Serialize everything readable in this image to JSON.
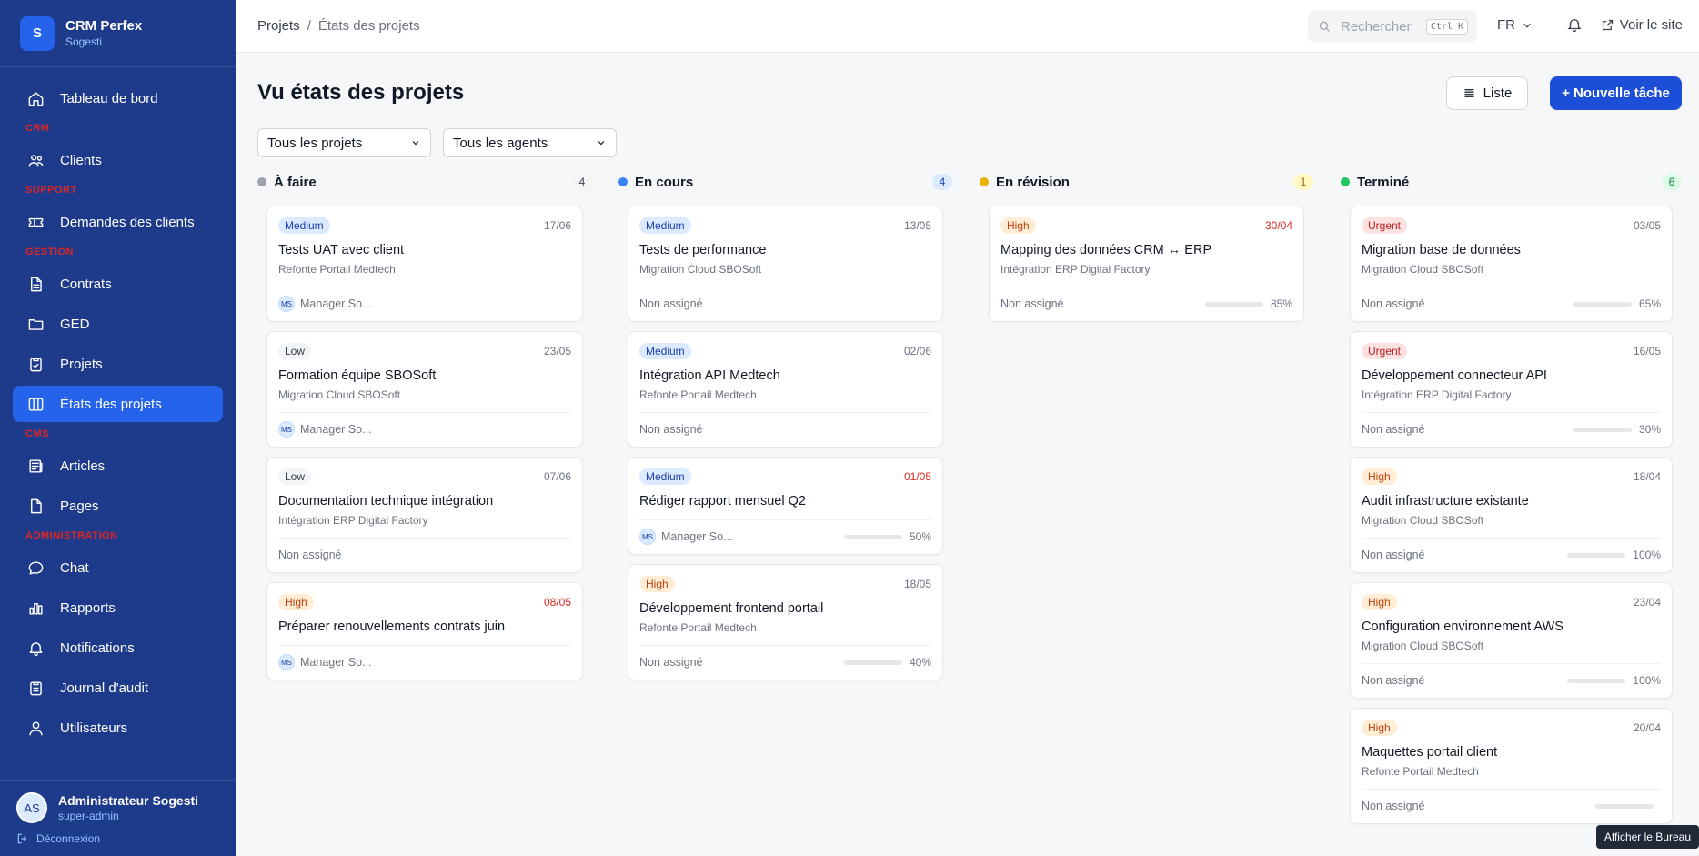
{
  "sidebar": {
    "brand_title": "CRM Perfex",
    "brand_sub": "Sogesti",
    "logo_letter": "S",
    "items": [
      {
        "label": "Tableau de bord"
      },
      {
        "label": "CRM"
      },
      {
        "label": "Clients"
      },
      {
        "label": "SUPPORT"
      },
      {
        "label": "Demandes des clients"
      },
      {
        "label": "GESTION"
      },
      {
        "label": "Contrats"
      },
      {
        "label": "GED"
      },
      {
        "label": "Projets"
      },
      {
        "label": "États des projets"
      },
      {
        "label": "CMS"
      },
      {
        "label": "Articles"
      },
      {
        "label": "Pages"
      },
      {
        "label": "ADMINISTRATION"
      },
      {
        "label": "Chat"
      },
      {
        "label": "Rapports"
      },
      {
        "label": "Notifications"
      },
      {
        "label": "Journal d'audit"
      },
      {
        "label": "Utilisateurs"
      }
    ],
    "user": {
      "initials": "AS",
      "name": "Administrateur Sogesti",
      "role": "super-admin",
      "logout": "Déconnexion"
    }
  },
  "topbar": {
    "breadcrumb_root": "Projets",
    "breadcrumb_sep": "/",
    "breadcrumb_current": "États des projets",
    "search_placeholder": "Rechercher",
    "search_kbd": "Ctrl K",
    "lang": "FR",
    "visit": "Voir le site"
  },
  "page": {
    "title": "Vu états des projets",
    "list_button": "Liste",
    "new_button": "+ Nouvelle tâche",
    "filter_projects": "Tous les projets",
    "filter_agents": "Tous les agents"
  },
  "colors": {
    "todo": "#9ca3af",
    "progress": "#3b82f6",
    "review": "#eab308",
    "done": "#22c55e",
    "accent": "#2563eb"
  },
  "columns": [
    {
      "title": "À faire",
      "count": "4",
      "cards": [
        {
          "priority": "Medium",
          "date": "17/06",
          "title": "Tests UAT avec client",
          "project": "Refonte Portail Medtech",
          "assignee": "Manager So...",
          "initials": "MS"
        },
        {
          "priority": "Low",
          "date": "23/05",
          "title": "Formation équipe SBOSoft",
          "project": "Migration Cloud SBOSoft",
          "assignee": "Manager So...",
          "initials": "MS"
        },
        {
          "priority": "Low",
          "date": "07/06",
          "title": "Documentation technique intégration",
          "project": "Intégration ERP Digital Factory",
          "assignee": "Non assigné"
        },
        {
          "priority": "High",
          "date": "08/05",
          "title": "Préparer renouvellements contrats juin",
          "assignee": "Manager So...",
          "initials": "MS"
        }
      ]
    },
    {
      "title": "En cours",
      "count": "4",
      "cards": [
        {
          "priority": "Medium",
          "date": "13/05",
          "title": "Tests de performance",
          "project": "Migration Cloud SBOSoft",
          "assignee": "Non assigné"
        },
        {
          "priority": "Medium",
          "date": "02/06",
          "title": "Intégration API Medtech",
          "project": "Refonte Portail Medtech",
          "assignee": "Non assigné"
        },
        {
          "priority": "Medium",
          "date": "01/05",
          "title": "Rédiger rapport mensuel Q2",
          "assignee": "Manager So...",
          "initials": "MS",
          "progress": "50%"
        },
        {
          "priority": "High",
          "date": "18/05",
          "title": "Développement frontend portail",
          "project": "Refonte Portail Medtech",
          "assignee": "Non assigné",
          "progress": "40%"
        }
      ]
    },
    {
      "title": "En révision",
      "count": "1",
      "cards": [
        {
          "priority": "High",
          "date": "30/04",
          "title": "Mapping des données CRM ↔ ERP",
          "project": "Intégration ERP Digital Factory",
          "assignee": "Non assigné",
          "progress": "85%"
        }
      ]
    },
    {
      "title": "Terminé",
      "count": "6",
      "cards": [
        {
          "priority": "Urgent",
          "date": "03/05",
          "title": "Migration base de données",
          "project": "Migration Cloud SBOSoft",
          "assignee": "Non assigné",
          "progress": "65%"
        },
        {
          "priority": "Urgent",
          "date": "16/05",
          "title": "Développement connecteur API",
          "project": "Intégration ERP Digital Factory",
          "assignee": "Non assigné",
          "progress": "30%"
        },
        {
          "priority": "High",
          "date": "18/04",
          "title": "Audit infrastructure existante",
          "project": "Migration Cloud SBOSoft",
          "assignee": "Non assigné",
          "progress": "100%"
        },
        {
          "priority": "High",
          "date": "23/04",
          "title": "Configuration environnement AWS",
          "project": "Migration Cloud SBOSoft",
          "assignee": "Non assigné",
          "progress": "100%"
        },
        {
          "priority": "High",
          "date": "20/04",
          "title": "Maquettes portail client",
          "project": "Refonte Portail Medtech",
          "assignee": "Non assigné"
        }
      ]
    }
  ],
  "tooltip": "Afficher le Bureau"
}
